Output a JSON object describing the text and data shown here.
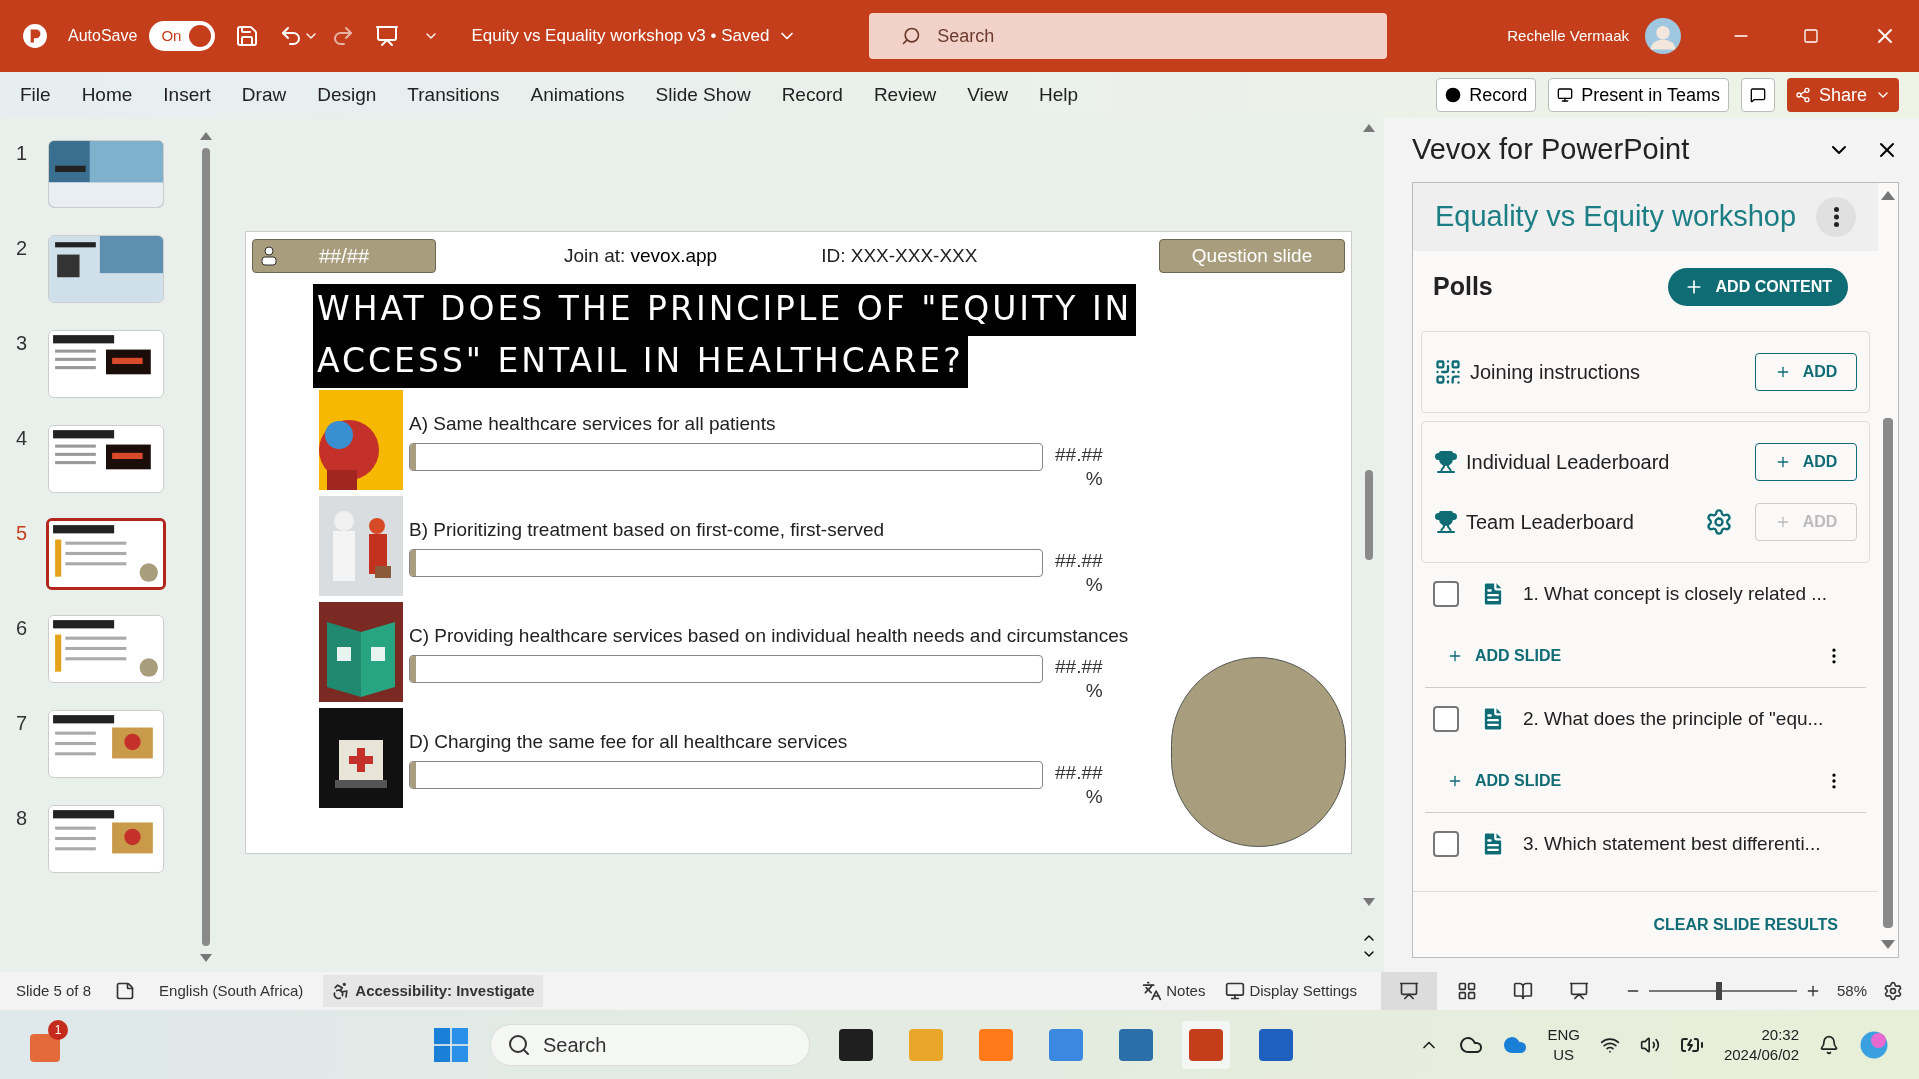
{
  "title_bar": {
    "app_label": "AutoSave",
    "autosave": {
      "on": true,
      "label": "On"
    },
    "document_title": "Equity vs Equality workshop v3 • Saved",
    "search_placeholder": "Search",
    "user_name": "Rechelle Vermaak"
  },
  "menu": [
    "File",
    "Home",
    "Insert",
    "Draw",
    "Design",
    "Transitions",
    "Animations",
    "Slide Show",
    "Record",
    "Review",
    "View",
    "Help"
  ],
  "ribbon_buttons": {
    "record": "Record",
    "teams": "Present in Teams",
    "share": "Share"
  },
  "slides": [
    {
      "number": "1",
      "selected": false,
      "kind": "title"
    },
    {
      "number": "2",
      "selected": false,
      "kind": "join"
    },
    {
      "number": "3",
      "selected": false,
      "kind": "change"
    },
    {
      "number": "4",
      "selected": false,
      "kind": "change"
    },
    {
      "number": "5",
      "selected": true,
      "kind": "poll"
    },
    {
      "number": "6",
      "selected": false,
      "kind": "poll"
    },
    {
      "number": "7",
      "selected": false
    },
    {
      "number": "8",
      "selected": false
    }
  ],
  "slide": {
    "participants": "##/##",
    "join_label": "Join at:",
    "join_url": "vevox.app",
    "session_id": "ID: XXX-XXX-XXX",
    "slide_type": "Question slide",
    "question_lines": [
      "WHAT DOES THE PRINCIPLE OF \"EQUITY IN",
      "ACCESS\" ENTAIL IN HEALTHCARE?"
    ],
    "options": [
      {
        "text": "A) Same healthcare services for all patients",
        "value": "##.##",
        "unit": "%",
        "level": 0.01
      },
      {
        "text": "B) Prioritizing treatment based on first-come, first-served",
        "value": "##.##",
        "unit": "%",
        "level": 0.01
      },
      {
        "text": "C) Providing healthcare services based on individual health needs and circumstances",
        "value": "##.##",
        "unit": "%",
        "level": 0.01
      },
      {
        "text": "D) Charging the same fee for all healthcare services",
        "value": "##.##",
        "unit": "%",
        "level": 0.01
      }
    ]
  },
  "pane": {
    "title": "Vevox for PowerPoint",
    "session": "Equality vs Equity workshop",
    "section": "Polls",
    "add_content": "ADD CONTENT",
    "features": [
      {
        "label": "Joining instructions",
        "kind": "qr",
        "button": "ADD",
        "disabled": false,
        "settings": false
      },
      {
        "label": "Individual Leaderboard",
        "kind": "trophy",
        "button": "ADD",
        "disabled": false,
        "settings": false
      },
      {
        "label": "Team Leaderboard",
        "kind": "trophy",
        "button": "ADD",
        "disabled": true,
        "settings": true
      }
    ],
    "polls": [
      {
        "text": "1. What concept is closely related ...",
        "checked": false,
        "add_slide": "ADD SLIDE"
      },
      {
        "text": "2. What does the principle of \"equ...",
        "checked": false,
        "add_slide": "ADD SLIDE"
      },
      {
        "text": "3. Which statement best differenti...",
        "checked": false
      }
    ],
    "clear": "CLEAR SLIDE RESULTS"
  },
  "status_bar": {
    "slide": "Slide 5 of 8",
    "language": "English (South Africa)",
    "accessibility": "Accessibility: Investigate",
    "notes": "Notes",
    "display": "Display Settings",
    "zoom": "58%",
    "zoom_slider": {
      "level": 0.45
    }
  },
  "taskbar": {
    "badge": "1",
    "search": "Search",
    "lang": "ENG",
    "region": "US",
    "time": "20:32",
    "date": "2024/06/02"
  }
}
